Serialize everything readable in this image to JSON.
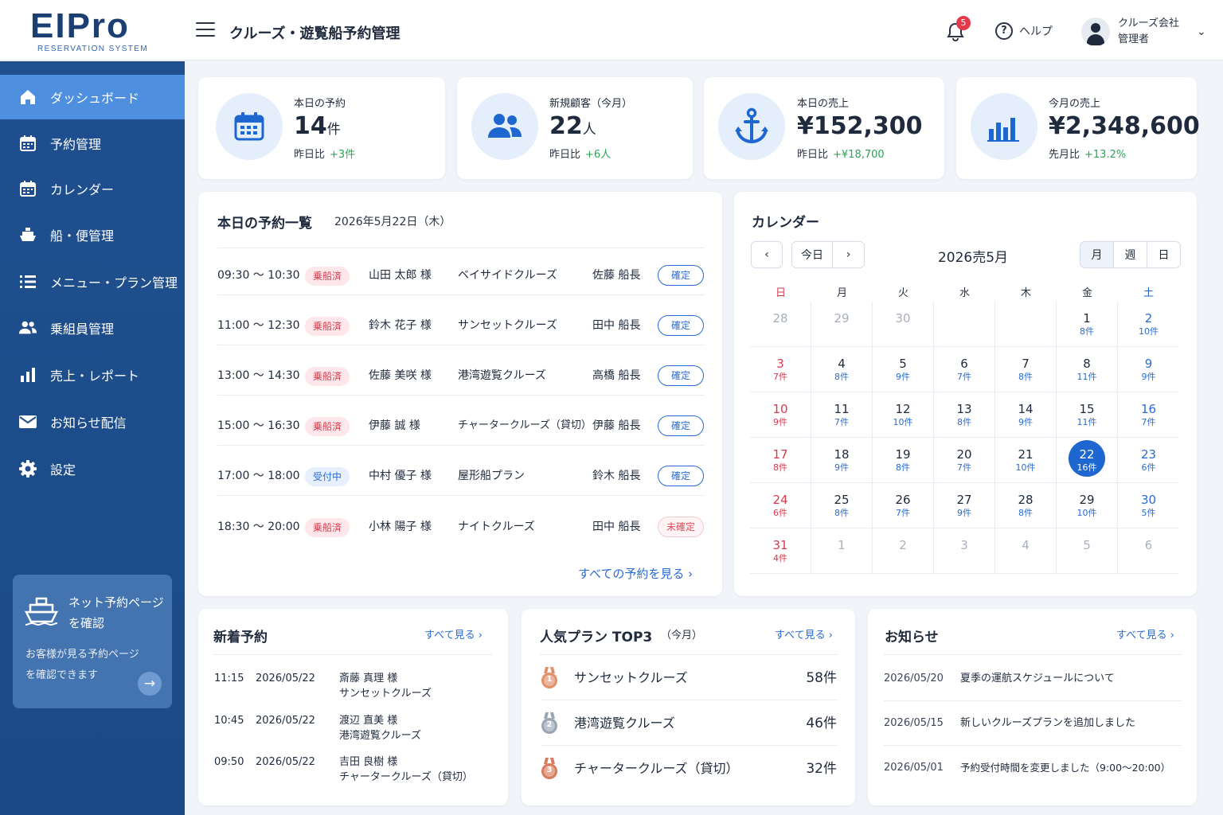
{
  "header": {
    "logo_text": "EIPro",
    "logo_sub": "RESERVATION SYSTEM",
    "title": "クルーズ・遊覧船予約管理",
    "notification_count": "5",
    "help_label": "ヘルプ",
    "user_company": "クルーズ会社",
    "user_role": "管理者"
  },
  "sidebar": {
    "items": [
      {
        "label": "ダッシュボード",
        "icon": "home-icon",
        "active": true
      },
      {
        "label": "予約管理",
        "icon": "calendar-icon"
      },
      {
        "label": "カレンダー",
        "icon": "calendar-icon"
      },
      {
        "label": "船・便管理",
        "icon": "ship-icon"
      },
      {
        "label": "メニュー・プラン管理",
        "icon": "list-icon"
      },
      {
        "label": "乗組員管理",
        "icon": "users-icon"
      },
      {
        "label": "売上・レポート",
        "icon": "bar-chart-icon"
      },
      {
        "label": "お知らせ配信",
        "icon": "mail-icon"
      },
      {
        "label": "設定",
        "icon": "gear-icon"
      }
    ],
    "promo": {
      "title_line1": "ネット予約ページ",
      "title_line2": "を確認",
      "desc_line1": "お客様が見る予約ページ",
      "desc_line2": "を確認できます"
    }
  },
  "stats": [
    {
      "label": "本日の予約",
      "value": "14",
      "unit": "件",
      "sub_label": "昨日比",
      "sub_value": "+3件",
      "icon": "calendar-icon"
    },
    {
      "label": "新規顧客（今月）",
      "value": "22",
      "unit": "人",
      "sub_label": "昨日比",
      "sub_value": "+6人",
      "icon": "users-icon"
    },
    {
      "label": "本日の売上",
      "value": "¥152,300",
      "unit": "",
      "sub_label": "昨日比",
      "sub_value": "+¥18,700",
      "icon": "anchor-icon"
    },
    {
      "label": "今月の売上",
      "value": "¥2,348,600",
      "unit": "",
      "sub_label": "先月比",
      "sub_value": "+13.2%",
      "icon": "bar-chart-icon"
    }
  ],
  "reservations": {
    "title": "本日の予約一覧",
    "date": "2026年5月22日（木）",
    "rows": [
      {
        "time": "09:30 ～ 10:30",
        "tag": "乗船済",
        "customer": "山田 太郎 様",
        "plan": "ベイサイドクルーズ",
        "captain": "佐藤 船長",
        "status": "確定"
      },
      {
        "time": "11:00 ～ 12:30",
        "tag": "乗船済",
        "customer": "鈴木 花子 様",
        "plan": "サンセットクルーズ",
        "captain": "田中 船長",
        "status": "確定"
      },
      {
        "time": "13:00 ～ 14:30",
        "tag": "乗船済",
        "customer": "佐藤 美咲 様",
        "plan": "港湾遊覧クルーズ",
        "captain": "高橋 船長",
        "status": "確定"
      },
      {
        "time": "15:00 ～ 16:30",
        "tag": "乗船済",
        "customer": "伊藤 誠 様",
        "plan": "チャータークルーズ（貸切）",
        "captain": "伊藤 船長",
        "status": "確定"
      },
      {
        "time": "17:00 ～ 18:00",
        "tag": "受付中",
        "customer": "中村 優子 様",
        "plan": "屋形船プラン",
        "captain": "鈴木 船長",
        "status": "確定"
      },
      {
        "time": "18:30 ～ 20:00",
        "tag": "乗船済",
        "customer": "小林 陽子 様",
        "plan": "ナイトクルーズ",
        "captain": "田中 船長",
        "status": "未確定"
      }
    ],
    "view_all": "すべての予約を見る ›"
  },
  "calendar": {
    "title": "カレンダー",
    "today_btn": "今日",
    "month_label": "2026売5月",
    "views": [
      "月",
      "週",
      "日"
    ],
    "weekdays": [
      "日",
      "月",
      "火",
      "水",
      "木",
      "金",
      "土"
    ],
    "weeks": [
      [
        {
          "d": "28",
          "other": true
        },
        {
          "d": "29",
          "other": true
        },
        {
          "d": "30",
          "other": true
        },
        {
          "d": ""
        },
        {
          "d": ""
        },
        {
          "d": "1",
          "c": "8件"
        },
        {
          "d": "2",
          "c": "10件"
        }
      ],
      [
        {
          "d": "3",
          "c": "7件"
        },
        {
          "d": "4",
          "c": "8件"
        },
        {
          "d": "5",
          "c": "9件"
        },
        {
          "d": "6",
          "c": "7件"
        },
        {
          "d": "7",
          "c": "8件"
        },
        {
          "d": "8",
          "c": "11件"
        },
        {
          "d": "9",
          "c": "9件"
        }
      ],
      [
        {
          "d": "10",
          "c": "9件"
        },
        {
          "d": "11",
          "c": "7件"
        },
        {
          "d": "12",
          "c": "10件"
        },
        {
          "d": "13",
          "c": "8件"
        },
        {
          "d": "14",
          "c": "9件"
        },
        {
          "d": "15",
          "c": "11件"
        },
        {
          "d": "16",
          "c": "7件"
        }
      ],
      [
        {
          "d": "17",
          "c": "8件"
        },
        {
          "d": "18",
          "c": "9件"
        },
        {
          "d": "19",
          "c": "8件"
        },
        {
          "d": "20",
          "c": "7件"
        },
        {
          "d": "21",
          "c": "10件"
        },
        {
          "d": "22",
          "c": "16件",
          "today": true
        },
        {
          "d": "23",
          "c": "6件"
        }
      ],
      [
        {
          "d": "24",
          "c": "6件"
        },
        {
          "d": "25",
          "c": "8件"
        },
        {
          "d": "26",
          "c": "7件"
        },
        {
          "d": "27",
          "c": "9件"
        },
        {
          "d": "28",
          "c": "8件"
        },
        {
          "d": "29",
          "c": "10件"
        },
        {
          "d": "30",
          "c": "5件"
        }
      ],
      [
        {
          "d": "31",
          "c": "4件"
        },
        {
          "d": "1",
          "other": true
        },
        {
          "d": "2",
          "other": true
        },
        {
          "d": "3",
          "other": true
        },
        {
          "d": "4",
          "other": true
        },
        {
          "d": "5",
          "other": true
        },
        {
          "d": "6",
          "other": true
        }
      ]
    ]
  },
  "new_bookings": {
    "title": "新着予約",
    "view_all": "すべて見る ›",
    "rows": [
      {
        "time": "11:15",
        "date": "2026/05/22",
        "name": "斎藤 真理 様",
        "plan": "サンセットクルーズ"
      },
      {
        "time": "10:45",
        "date": "2026/05/22",
        "name": "渡辺 直美 様",
        "plan": "港湾遊覧クルーズ"
      },
      {
        "time": "09:50",
        "date": "2026/05/22",
        "name": "吉田 良樹 様",
        "plan": "チャータークルーズ（貸切）"
      }
    ]
  },
  "popular": {
    "title": "人気プラン TOP3",
    "period": "（今月）",
    "view_all": "すべて見る ›",
    "rows": [
      {
        "rank": "1",
        "plan": "サンセットクルーズ",
        "count": "58件",
        "medal_color": "#e0906a"
      },
      {
        "rank": "2",
        "plan": "港湾遊覧クルーズ",
        "count": "46件",
        "medal_color": "#9aa5b3"
      },
      {
        "rank": "3",
        "plan": "チャータークルーズ（貸切）",
        "count": "32件",
        "medal_color": "#d97b5e"
      }
    ]
  },
  "news": {
    "title": "お知らせ",
    "view_all": "すべて見る ›",
    "rows": [
      {
        "date": "2026/05/20",
        "text": "夏季の運航スケジュールについて"
      },
      {
        "date": "2026/05/15",
        "text": "新しいクルーズプランを追加しました"
      },
      {
        "date": "2026/05/01",
        "text": "予約受付時間を変更しました（9:00〜20:00）"
      }
    ]
  },
  "colors": {
    "primary": "#1e66d0",
    "sidebar": "#1f4f8f",
    "positive": "#2aa456",
    "sunday": "#d63a4c"
  }
}
